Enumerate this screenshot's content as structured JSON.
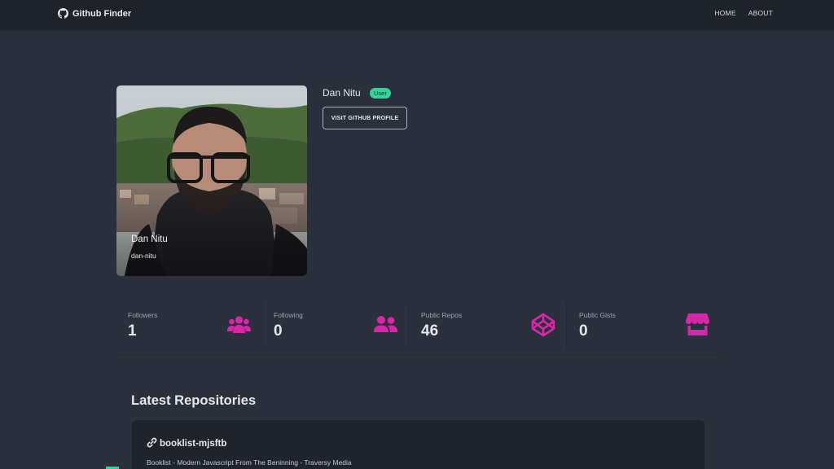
{
  "navbar": {
    "brand": "Github Finder",
    "brand_icon": "github-icon",
    "links": [
      "HOME",
      "ABOUT"
    ]
  },
  "profile": {
    "name": "Dan Nitu",
    "login": "dan-nitu",
    "type_badge": "User",
    "visit_button": "VISIT GITHUB PROFILE",
    "avatar": "avatar-photo"
  },
  "stats": [
    {
      "title": "Followers",
      "value": "1",
      "icon": "users-icon"
    },
    {
      "title": "Following",
      "value": "0",
      "icon": "user-friends-icon"
    },
    {
      "title": "Public Repos",
      "value": "46",
      "icon": "codepen-icon"
    },
    {
      "title": "Public Gists",
      "value": "0",
      "icon": "store-icon"
    }
  ],
  "repos": {
    "heading": "Latest Repositories",
    "items": [
      {
        "name": "booklist-mjsftb",
        "description": "Booklist - Modern Javascript From The Beninning - Traversy Media",
        "icon": "link-icon"
      }
    ]
  },
  "colors": {
    "background": "#2a303c",
    "navbar": "#1e222b",
    "accent_pink": "#d926a9",
    "badge_green": "#36d399",
    "card": "#1f232c"
  }
}
